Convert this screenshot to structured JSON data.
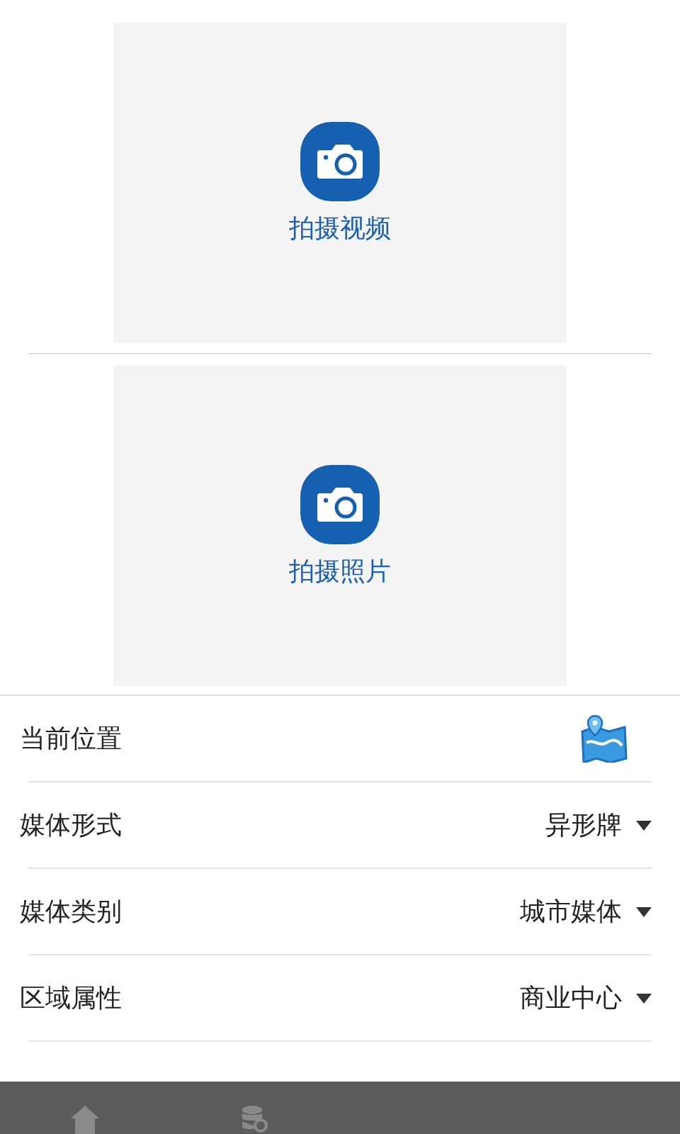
{
  "capture": [
    {
      "label": "拍摄视频"
    },
    {
      "label": "拍摄照片"
    }
  ],
  "fields": [
    {
      "kind": "location",
      "label": "当前位置"
    },
    {
      "kind": "select",
      "label": "媒体形式",
      "value": "异形牌"
    },
    {
      "kind": "select",
      "label": "媒体类别",
      "value": "城市媒体"
    },
    {
      "kind": "select",
      "label": "区域属性",
      "value": "商业中心"
    }
  ]
}
